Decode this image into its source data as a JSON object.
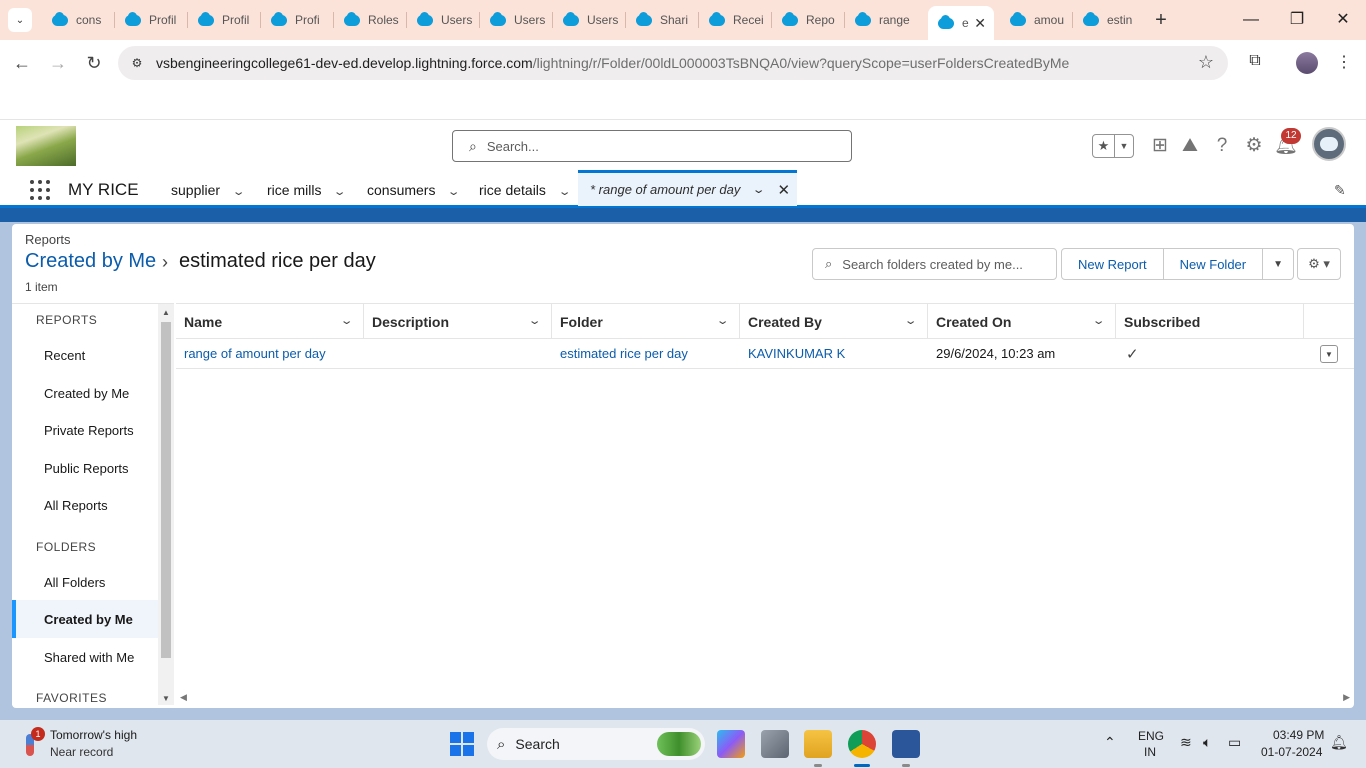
{
  "browser": {
    "tabs": [
      {
        "label": "cons"
      },
      {
        "label": "Profil"
      },
      {
        "label": "Profil"
      },
      {
        "label": "Profi"
      },
      {
        "label": "Roles"
      },
      {
        "label": "Users"
      },
      {
        "label": "Users"
      },
      {
        "label": "Users"
      },
      {
        "label": "Shari"
      },
      {
        "label": "Recei"
      },
      {
        "label": "Repo"
      },
      {
        "label": "range"
      },
      {
        "label": "e"
      },
      {
        "label": "amou"
      },
      {
        "label": "estin"
      }
    ],
    "active_tab_index": 12,
    "url_host": "vsbengineeringcollege61-dev-ed.develop.lightning.force.com",
    "url_path": "/lightning/r/Folder/00ldL000003TsBNQA0/view?queryScope=userFoldersCreatedByMe"
  },
  "sf_header": {
    "search_placeholder": "Search...",
    "notification_count": "12"
  },
  "app_nav": {
    "app_name": "MY RICE",
    "items": [
      {
        "label": "supplier"
      },
      {
        "label": "rice mills"
      },
      {
        "label": "consumers"
      },
      {
        "label": "rice details"
      }
    ],
    "open_tab": "* range of amount per day"
  },
  "page": {
    "section": "Reports",
    "breadcrumb_link": "Created by Me",
    "title": "estimated rice per day",
    "item_count": "1 item",
    "search_placeholder": "Search folders created by me...",
    "new_report_label": "New Report",
    "new_folder_label": "New Folder"
  },
  "sidebar": {
    "reports_heading": "REPORTS",
    "report_items": [
      {
        "label": "Recent"
      },
      {
        "label": "Created by Me"
      },
      {
        "label": "Private Reports"
      },
      {
        "label": "Public Reports"
      },
      {
        "label": "All Reports"
      }
    ],
    "folders_heading": "FOLDERS",
    "folder_items": [
      {
        "label": "All Folders"
      },
      {
        "label": "Created by Me",
        "selected": true
      },
      {
        "label": "Shared with Me"
      }
    ],
    "favorites_heading": "FAVORITES"
  },
  "table": {
    "columns": [
      {
        "label": "Name"
      },
      {
        "label": "Description"
      },
      {
        "label": "Folder"
      },
      {
        "label": "Created By"
      },
      {
        "label": "Created On"
      },
      {
        "label": "Subscribed"
      }
    ],
    "rows": [
      {
        "name": "range of amount per day",
        "description": "",
        "folder": "estimated rice per day",
        "created_by": "KAVINKUMAR K",
        "created_on": "29/6/2024, 10:23 am",
        "subscribed": "✓"
      }
    ]
  },
  "taskbar": {
    "weather_line1": "Tomorrow's high",
    "weather_line2": "Near record",
    "weather_badge": "1",
    "search_label": "Search",
    "lang_line1": "ENG",
    "lang_line2": "IN",
    "time": "03:49 PM",
    "date": "01-07-2024"
  },
  "colors": {
    "brand_blue": "#0176d3",
    "link_blue": "#0b5cab",
    "notification_red": "#c23934",
    "tabstrip_bg": "#fbe3d9"
  }
}
